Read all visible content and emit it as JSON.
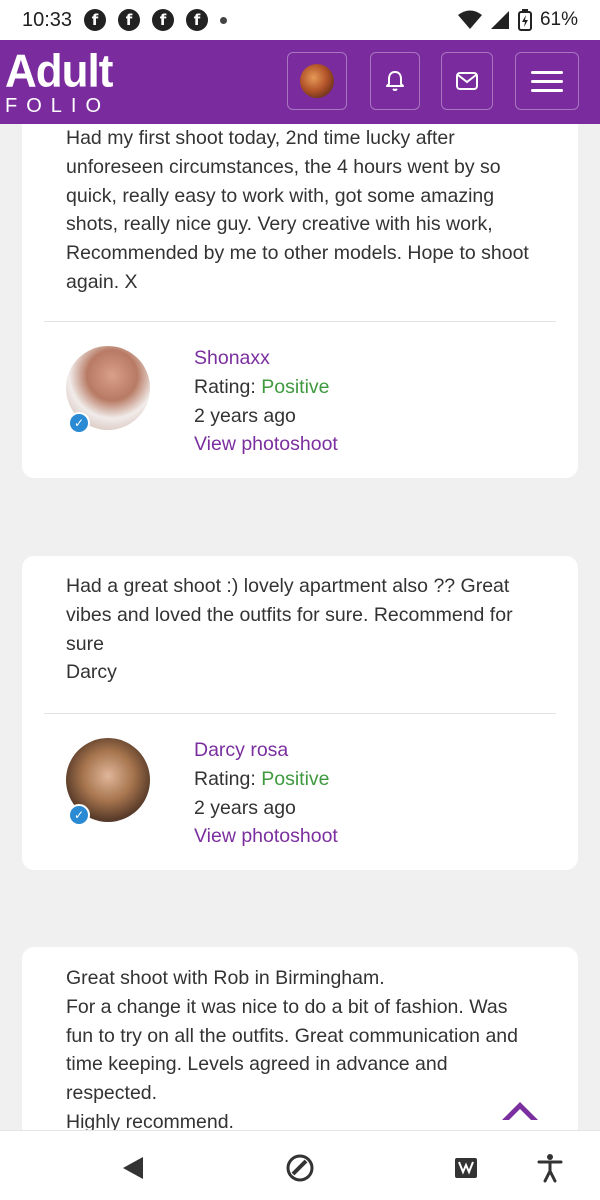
{
  "status_bar": {
    "time": "10:33",
    "notification_icons": [
      "f",
      "f",
      "f",
      "f"
    ],
    "battery": "61%"
  },
  "header": {
    "logo_main": "Adult",
    "logo_sub": "FOLIO",
    "brand_color": "#7a2c9e"
  },
  "reviews": [
    {
      "text": "Had my first shoot today, 2nd time lucky after unforeseen circumstances, the 4 hours went by so quick, really easy to work with, got some amazing shots, really nice guy. Very creative with his work, Recommended by me to other models. Hope to shoot again. X",
      "author": "Shonaxx",
      "rating_label": "Rating:",
      "rating_value": "Positive",
      "time_ago": "2 years ago",
      "link": "View photoshoot"
    },
    {
      "text": "Had a great shoot :) lovely apartment also ?? Great vibes and loved the outfits for sure. Recommend for sure\nDarcy",
      "author": "Darcy rosa",
      "rating_label": "Rating:",
      "rating_value": "Positive",
      "time_ago": "2 years ago",
      "link": "View photoshoot"
    },
    {
      "text": "Great shoot with Rob in Birmingham.\nFor a change it was nice to do a bit of fashion. Was fun to try on all the outfits. Great communication and time keeping. Levels agreed in advance and respected.\nHighly recommend."
    }
  ],
  "colors": {
    "link": "#7b2f9f",
    "positive": "#3f9a3f",
    "verified": "#2a8bd4"
  }
}
